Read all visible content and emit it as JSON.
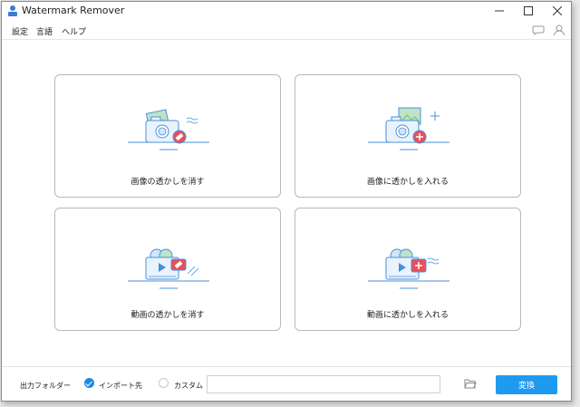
{
  "window": {
    "title": "Watermark Remover"
  },
  "menu": {
    "settings": "設定",
    "language": "言語",
    "help": "ヘルプ"
  },
  "cards": [
    {
      "label": "画像の透かしを消す",
      "icon": "image-erase-icon"
    },
    {
      "label": "画像に透かしを入れる",
      "icon": "image-add-icon"
    },
    {
      "label": "動画の透かしを消す",
      "icon": "video-erase-icon"
    },
    {
      "label": "動画に透かしを入れる",
      "icon": "video-add-icon"
    }
  ],
  "footer": {
    "output_label": "出力フォルダー",
    "option_import": "インポート先",
    "option_custom": "カスタム",
    "path_value": "",
    "convert_label": "変換",
    "selected_option": "インポート先"
  },
  "colors": {
    "accent": "#1e9bf0",
    "icon_blue": "#4a90d9",
    "icon_red": "#e8505b",
    "icon_green": "#6fbf73"
  }
}
